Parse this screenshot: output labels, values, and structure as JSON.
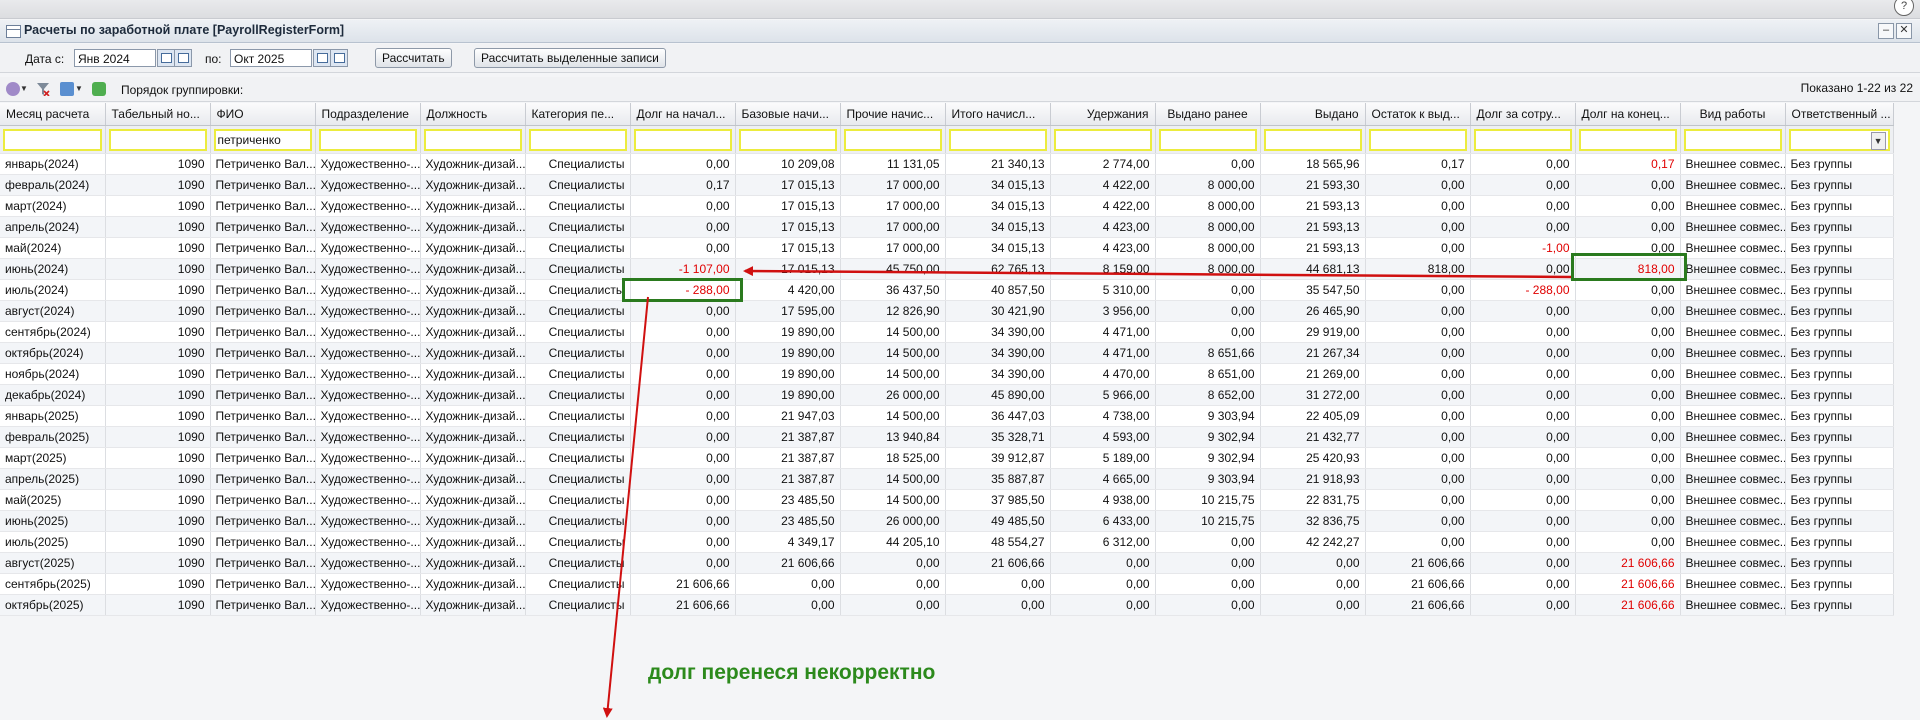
{
  "window": {
    "title": "Расчеты по заработной плате [PayrollRegisterForm]",
    "minimize": "–",
    "close": "✕"
  },
  "help_glyph": "?",
  "filters": {
    "date_from_label": "Дата с:",
    "date_from": "Янв 2024",
    "date_to_label": "по:",
    "date_to": "Окт 2025",
    "calc_button": "Рассчитать",
    "calc_selected_button": "Рассчитать выделенные записи"
  },
  "toolbar": {
    "grouping_label": "Порядок группировки:",
    "shown": "Показано 1-22 из 22"
  },
  "columns": [
    {
      "label": "Месяц расчета",
      "align": "l"
    },
    {
      "label": "Табельный но...",
      "align": "l"
    },
    {
      "label": "ФИО",
      "align": "l"
    },
    {
      "label": "Подразделение",
      "align": "l"
    },
    {
      "label": "Должность",
      "align": "l"
    },
    {
      "label": "Категория пе...",
      "align": "l"
    },
    {
      "label": "Долг на начал...",
      "align": "l"
    },
    {
      "label": "Базовые начи...",
      "align": "l"
    },
    {
      "label": "Прочие начис...",
      "align": "l"
    },
    {
      "label": "Итого начисл...",
      "align": "l"
    },
    {
      "label": "Удержания",
      "align": "r"
    },
    {
      "label": "Выдано ранее",
      "align": "c"
    },
    {
      "label": "Выдано",
      "align": "r"
    },
    {
      "label": "Остаток к выд...",
      "align": "l"
    },
    {
      "label": "Долг за сотру...",
      "align": "l"
    },
    {
      "label": "Долг на конец...",
      "align": "l"
    },
    {
      "label": "Вид работы",
      "align": "c"
    },
    {
      "label": "Ответственный ...",
      "align": "l"
    }
  ],
  "filter_values": {
    "fio": "петриченко"
  },
  "rows": [
    [
      "январь(2024)",
      "1090",
      "Петриченко Вал...",
      "Художественно-...",
      "Художник-дизай...",
      "Специалисты",
      "0,00",
      "10 209,08",
      "11 131,05",
      "21 340,13",
      "2 774,00",
      "0,00",
      "18 565,96",
      "0,17",
      "0,00",
      "0,17",
      "Внешнее совмес...",
      "Без группы"
    ],
    [
      "февраль(2024)",
      "1090",
      "Петриченко Вал...",
      "Художественно-...",
      "Художник-дизай...",
      "Специалисты",
      "0,17",
      "17 015,13",
      "17 000,00",
      "34 015,13",
      "4 422,00",
      "8 000,00",
      "21 593,30",
      "0,00",
      "0,00",
      "0,00",
      "Внешнее совмес...",
      "Без группы"
    ],
    [
      "март(2024)",
      "1090",
      "Петриченко Вал...",
      "Художественно-...",
      "Художник-дизай...",
      "Специалисты",
      "0,00",
      "17 015,13",
      "17 000,00",
      "34 015,13",
      "4 422,00",
      "8 000,00",
      "21 593,13",
      "0,00",
      "0,00",
      "0,00",
      "Внешнее совмес...",
      "Без группы"
    ],
    [
      "апрель(2024)",
      "1090",
      "Петриченко Вал...",
      "Художественно-...",
      "Художник-дизай...",
      "Специалисты",
      "0,00",
      "17 015,13",
      "17 000,00",
      "34 015,13",
      "4 423,00",
      "8 000,00",
      "21 593,13",
      "0,00",
      "0,00",
      "0,00",
      "Внешнее совмес...",
      "Без группы"
    ],
    [
      "май(2024)",
      "1090",
      "Петриченко Вал...",
      "Художественно-...",
      "Художник-дизай...",
      "Специалисты",
      "0,00",
      "17 015,13",
      "17 000,00",
      "34 015,13",
      "4 423,00",
      "8 000,00",
      "21 593,13",
      "0,00",
      "-1,00",
      "0,00",
      "Внешнее совмес...",
      "Без группы"
    ],
    [
      "июнь(2024)",
      "1090",
      "Петриченко Вал...",
      "Художественно-...",
      "Художник-дизай...",
      "Специалисты",
      "-1 107,00",
      "17 015,13",
      "45 750,00",
      "62 765,13",
      "8 159,00",
      "8 000,00",
      "44 681,13",
      "818,00",
      "0,00",
      "818,00",
      "Внешнее совмес...",
      "Без группы"
    ],
    [
      "июль(2024)",
      "1090",
      "Петриченко Вал...",
      "Художественно-...",
      "Художник-дизай...",
      "Специалисты",
      "- 288,00",
      "4 420,00",
      "36 437,50",
      "40 857,50",
      "5 310,00",
      "0,00",
      "35 547,50",
      "0,00",
      "- 288,00",
      "0,00",
      "Внешнее совмес...",
      "Без группы"
    ],
    [
      "август(2024)",
      "1090",
      "Петриченко Вал...",
      "Художественно-...",
      "Художник-дизай...",
      "Специалисты",
      "0,00",
      "17 595,00",
      "12 826,90",
      "30 421,90",
      "3 956,00",
      "0,00",
      "26 465,90",
      "0,00",
      "0,00",
      "0,00",
      "Внешнее совмес...",
      "Без группы"
    ],
    [
      "сентябрь(2024)",
      "1090",
      "Петриченко Вал...",
      "Художественно-...",
      "Художник-дизай...",
      "Специалисты",
      "0,00",
      "19 890,00",
      "14 500,00",
      "34 390,00",
      "4 471,00",
      "0,00",
      "29 919,00",
      "0,00",
      "0,00",
      "0,00",
      "Внешнее совмес...",
      "Без группы"
    ],
    [
      "октябрь(2024)",
      "1090",
      "Петриченко Вал...",
      "Художественно-...",
      "Художник-дизай...",
      "Специалисты",
      "0,00",
      "19 890,00",
      "14 500,00",
      "34 390,00",
      "4 471,00",
      "8 651,66",
      "21 267,34",
      "0,00",
      "0,00",
      "0,00",
      "Внешнее совмес...",
      "Без группы"
    ],
    [
      "ноябрь(2024)",
      "1090",
      "Петриченко Вал...",
      "Художественно-...",
      "Художник-дизай...",
      "Специалисты",
      "0,00",
      "19 890,00",
      "14 500,00",
      "34 390,00",
      "4 470,00",
      "8 651,00",
      "21 269,00",
      "0,00",
      "0,00",
      "0,00",
      "Внешнее совмес...",
      "Без группы"
    ],
    [
      "декабрь(2024)",
      "1090",
      "Петриченко Вал...",
      "Художественно-...",
      "Художник-дизай...",
      "Специалисты",
      "0,00",
      "19 890,00",
      "26 000,00",
      "45 890,00",
      "5 966,00",
      "8 652,00",
      "31 272,00",
      "0,00",
      "0,00",
      "0,00",
      "Внешнее совмес...",
      "Без группы"
    ],
    [
      "январь(2025)",
      "1090",
      "Петриченко Вал...",
      "Художественно-...",
      "Художник-дизай...",
      "Специалисты",
      "0,00",
      "21 947,03",
      "14 500,00",
      "36 447,03",
      "4 738,00",
      "9 303,94",
      "22 405,09",
      "0,00",
      "0,00",
      "0,00",
      "Внешнее совмес...",
      "Без группы"
    ],
    [
      "февраль(2025)",
      "1090",
      "Петриченко Вал...",
      "Художественно-...",
      "Художник-дизай...",
      "Специалисты",
      "0,00",
      "21 387,87",
      "13 940,84",
      "35 328,71",
      "4 593,00",
      "9 302,94",
      "21 432,77",
      "0,00",
      "0,00",
      "0,00",
      "Внешнее совмес...",
      "Без группы"
    ],
    [
      "март(2025)",
      "1090",
      "Петриченко Вал...",
      "Художественно-...",
      "Художник-дизай...",
      "Специалисты",
      "0,00",
      "21 387,87",
      "18 525,00",
      "39 912,87",
      "5 189,00",
      "9 302,94",
      "25 420,93",
      "0,00",
      "0,00",
      "0,00",
      "Внешнее совмес...",
      "Без группы"
    ],
    [
      "апрель(2025)",
      "1090",
      "Петриченко Вал...",
      "Художественно-...",
      "Художник-дизай...",
      "Специалисты",
      "0,00",
      "21 387,87",
      "14 500,00",
      "35 887,87",
      "4 665,00",
      "9 303,94",
      "21 918,93",
      "0,00",
      "0,00",
      "0,00",
      "Внешнее совмес...",
      "Без группы"
    ],
    [
      "май(2025)",
      "1090",
      "Петриченко Вал...",
      "Художественно-...",
      "Художник-дизай...",
      "Специалисты",
      "0,00",
      "23 485,50",
      "14 500,00",
      "37 985,50",
      "4 938,00",
      "10 215,75",
      "22 831,75",
      "0,00",
      "0,00",
      "0,00",
      "Внешнее совмес...",
      "Без группы"
    ],
    [
      "июнь(2025)",
      "1090",
      "Петриченко Вал...",
      "Художественно-...",
      "Художник-дизай...",
      "Специалисты",
      "0,00",
      "23 485,50",
      "26 000,00",
      "49 485,50",
      "6 433,00",
      "10 215,75",
      "32 836,75",
      "0,00",
      "0,00",
      "0,00",
      "Внешнее совмес...",
      "Без группы"
    ],
    [
      "июль(2025)",
      "1090",
      "Петриченко Вал...",
      "Художественно-...",
      "Художник-дизай...",
      "Специалисты",
      "0,00",
      "4 349,17",
      "44 205,10",
      "48 554,27",
      "6 312,00",
      "0,00",
      "42 242,27",
      "0,00",
      "0,00",
      "0,00",
      "Внешнее совмес...",
      "Без группы"
    ],
    [
      "август(2025)",
      "1090",
      "Петриченко Вал...",
      "Художественно-...",
      "Художник-дизай...",
      "Специалисты",
      "0,00",
      "21 606,66",
      "0,00",
      "21 606,66",
      "0,00",
      "0,00",
      "0,00",
      "21 606,66",
      "0,00",
      "21 606,66",
      "Внешнее совмес...",
      "Без группы"
    ],
    [
      "сентябрь(2025)",
      "1090",
      "Петриченко Вал...",
      "Художественно-...",
      "Художник-дизай...",
      "Специалисты",
      "21 606,66",
      "0,00",
      "0,00",
      "0,00",
      "0,00",
      "0,00",
      "0,00",
      "21 606,66",
      "0,00",
      "21 606,66",
      "Внешнее совмес...",
      "Без группы"
    ],
    [
      "октябрь(2025)",
      "1090",
      "Петриченко Вал...",
      "Художественно-...",
      "Художник-дизай...",
      "Специалисты",
      "21 606,66",
      "0,00",
      "0,00",
      "0,00",
      "0,00",
      "0,00",
      "0,00",
      "21 606,66",
      "0,00",
      "21 606,66",
      "Внешнее совмес...",
      "Без группы"
    ]
  ],
  "red_cells": [
    [
      0,
      15
    ],
    [
      4,
      14
    ],
    [
      5,
      6
    ],
    [
      5,
      15
    ],
    [
      6,
      6
    ],
    [
      6,
      14
    ],
    [
      19,
      15
    ],
    [
      20,
      15
    ],
    [
      21,
      15
    ]
  ],
  "annotation": {
    "note": "долг перенеся некорректно",
    "color": "#2c8a1c",
    "arrow_color": "#d01010"
  }
}
